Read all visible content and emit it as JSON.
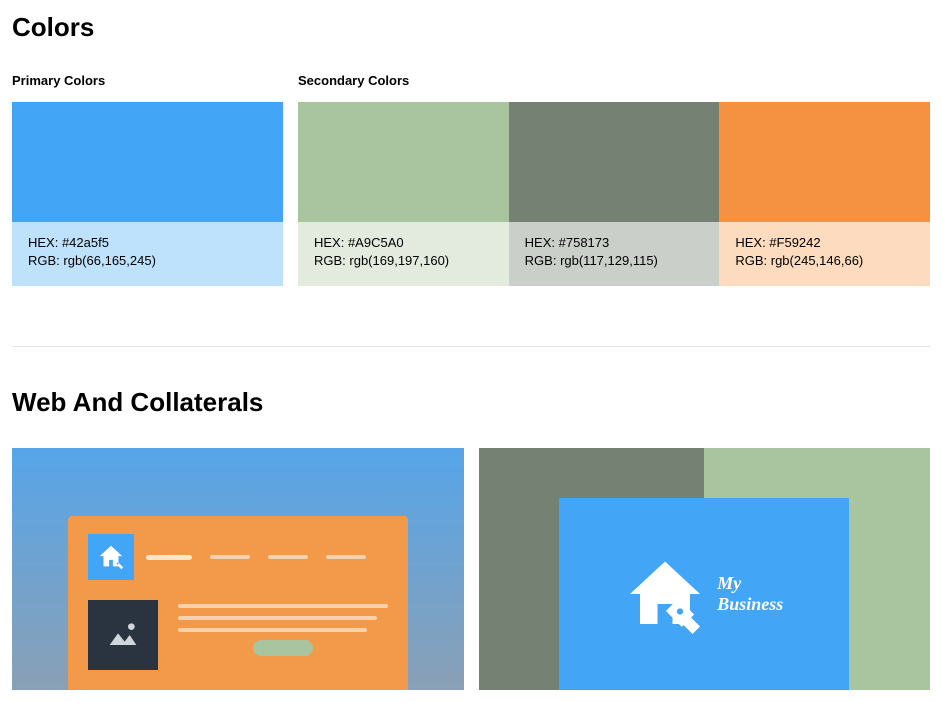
{
  "sections": {
    "colors_title": "Colors",
    "web_title": "Web And Collaterals"
  },
  "color_groups": {
    "primary_label": "Primary Colors",
    "secondary_label": "Secondary Colors"
  },
  "primary": [
    {
      "color": "#42a5f5",
      "meta_bg": "#BFE2FC",
      "hex_line": "HEX: #42a5f5",
      "rgb_line": "RGB: rgb(66,165,245)"
    }
  ],
  "secondary": [
    {
      "color": "#A9C5A0",
      "meta_bg": "#E2EBDE",
      "hex_line": "HEX: #A9C5A0",
      "rgb_line": "RGB: rgb(169,197,160)"
    },
    {
      "color": "#758173",
      "meta_bg": "#CAD0C9",
      "hex_line": "HEX: #758173",
      "rgb_line": "RGB: rgb(117,129,115)"
    },
    {
      "color": "#F59242",
      "meta_bg": "#FCDBBF",
      "hex_line": "HEX: #F59242",
      "rgb_line": "RGB: rgb(245,146,66)"
    }
  ],
  "business_card": {
    "line1": "My",
    "line2": "Business"
  }
}
